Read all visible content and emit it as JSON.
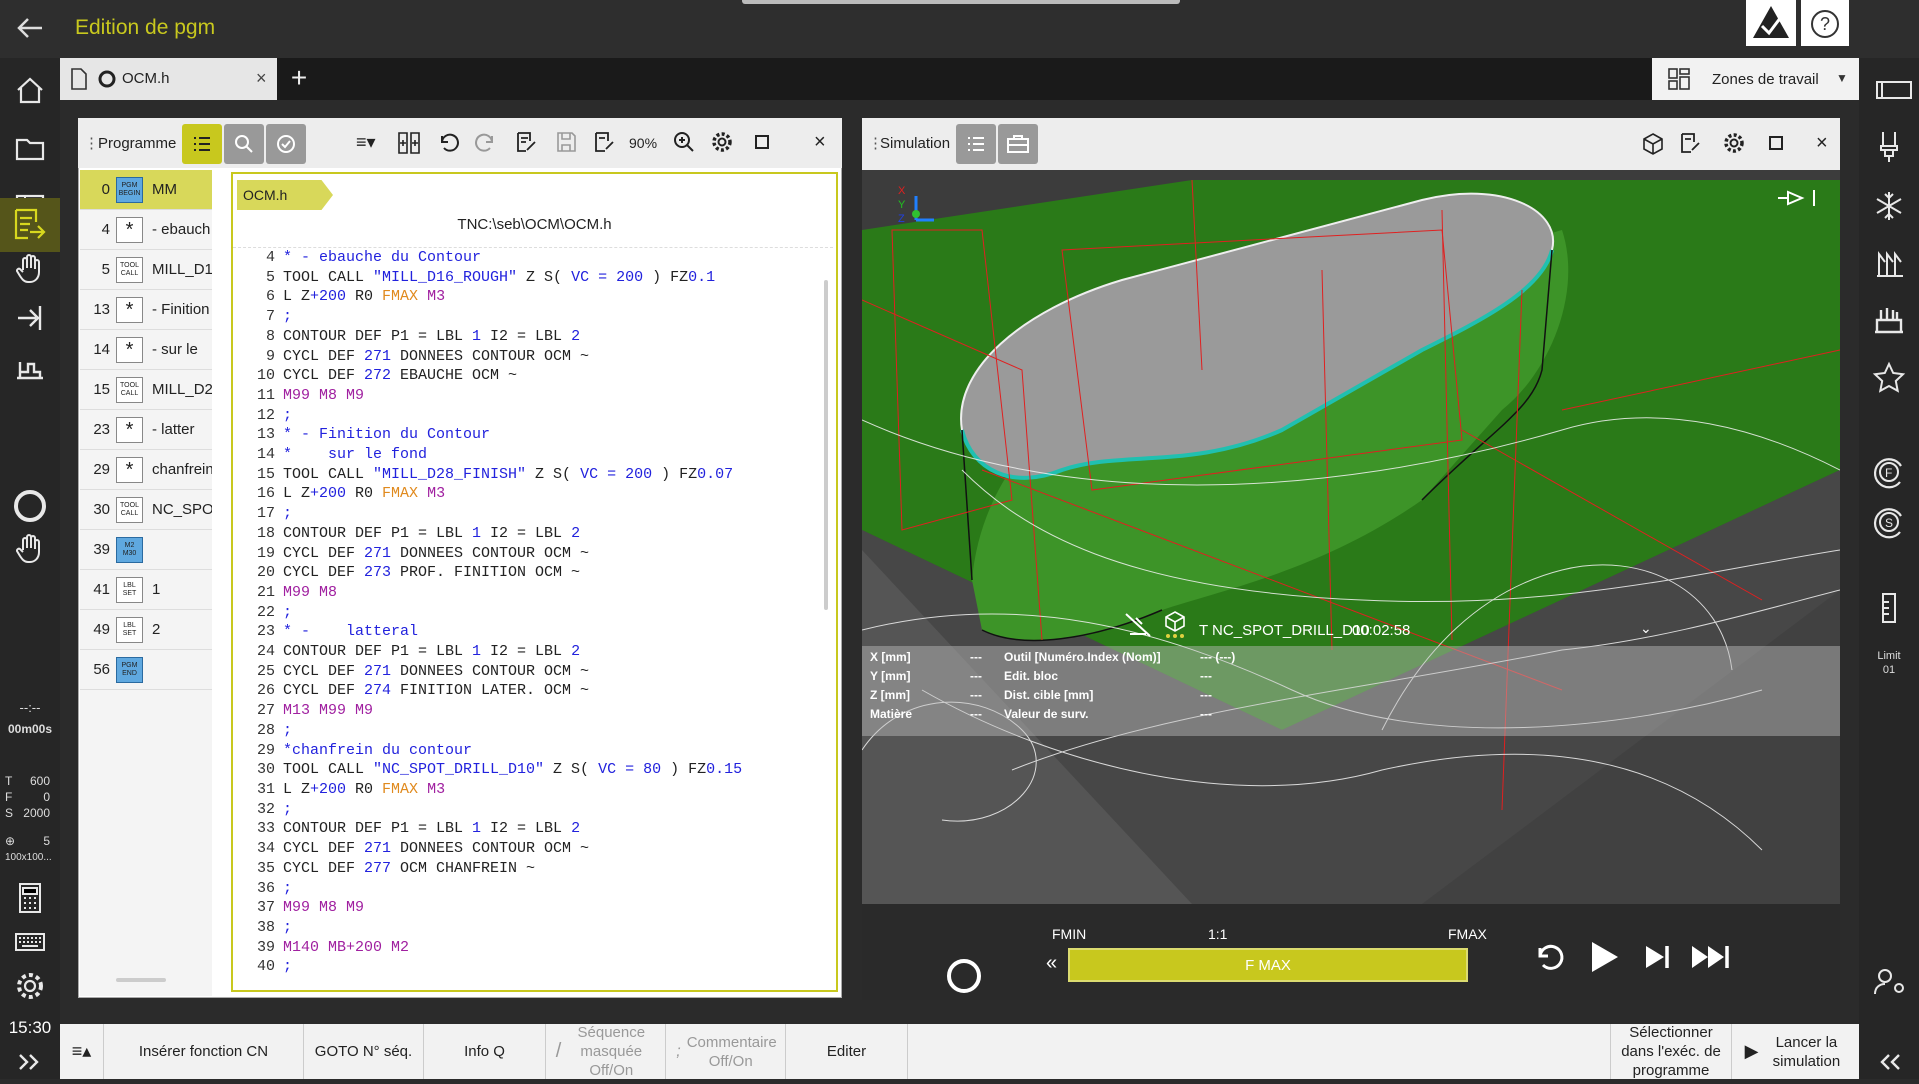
{
  "header": {
    "title": "Edition de pgm"
  },
  "tabs": [
    {
      "label": "OCM.h"
    }
  ],
  "zones": {
    "label": "Zones de travail"
  },
  "left_status": {
    "time_top": "--:--",
    "time": "00m00s",
    "T_label": "T",
    "T_value": "600",
    "F_label": "F",
    "F_value": "0",
    "S_label": "S",
    "S_value": "2000",
    "pos_value": "5",
    "pos_size": "100x100...",
    "clock": "15:30"
  },
  "program_panel": {
    "title": "Programme",
    "zoom": "90%",
    "breadcrumb": "OCM.h",
    "path": "TNC:\\seb\\OCM\\OCM.h",
    "blocks": [
      {
        "n": "0",
        "icon": "PGM BEGIN",
        "label": "MM"
      },
      {
        "n": "4",
        "icon": "*",
        "label": "- ebauch"
      },
      {
        "n": "5",
        "icon": "TOOL CALL",
        "label": "MILL_D1"
      },
      {
        "n": "13",
        "icon": "*",
        "label": "- Finition"
      },
      {
        "n": "14",
        "icon": "*",
        "label": "-    sur le"
      },
      {
        "n": "15",
        "icon": "TOOL CALL",
        "label": "MILL_D2"
      },
      {
        "n": "23",
        "icon": "*",
        "label": "-    latter"
      },
      {
        "n": "29",
        "icon": "*",
        "label": "chanfrein"
      },
      {
        "n": "30",
        "icon": "TOOL CALL",
        "label": "NC_SPO"
      },
      {
        "n": "39",
        "icon": "M2 M30",
        "label": ""
      },
      {
        "n": "41",
        "icon": "LBL SET",
        "label": "1"
      },
      {
        "n": "49",
        "icon": "LBL SET",
        "label": "2"
      },
      {
        "n": "56",
        "icon": "PGM END",
        "label": ""
      }
    ],
    "code_lines": [
      {
        "n": "4",
        "html": "<span class='bl'>* - ebauche du Contour</span>"
      },
      {
        "n": "5",
        "html": "TOOL CALL <span class='bl'>\"MILL_D16_ROUGH\"</span> Z S( <span class='bl'>VC = 200</span> ) FZ<span class='bl'>0.1</span>"
      },
      {
        "n": "6",
        "html": "L Z<span class='bl'>+200</span> R0 <span class='or'>FMAX</span> <span class='pu'>M3</span>"
      },
      {
        "n": "7",
        "html": "<span class='bl'>;</span>"
      },
      {
        "n": "8",
        "html": "CONTOUR DEF P1 = LBL <span class='bl'>1</span> I2 = LBL <span class='bl'>2</span>"
      },
      {
        "n": "9",
        "html": "CYCL DEF <span class='bl'>271</span> DONNEES CONTOUR OCM ~"
      },
      {
        "n": "10",
        "html": "CYCL DEF <span class='bl'>272</span> EBAUCHE OCM ~"
      },
      {
        "n": "11",
        "html": "<span class='pu'>M99 M8 M9</span>"
      },
      {
        "n": "12",
        "html": "<span class='bl'>;</span>"
      },
      {
        "n": "13",
        "html": "<span class='bl'>* - Finition du Contour</span>"
      },
      {
        "n": "14",
        "html": "<span class='bl'>*    sur le fond</span>"
      },
      {
        "n": "15",
        "html": "TOOL CALL <span class='bl'>\"MILL_D28_FINISH\"</span> Z S( <span class='bl'>VC = 200</span> ) FZ<span class='bl'>0.07</span>"
      },
      {
        "n": "16",
        "html": "L Z<span class='bl'>+200</span> R0 <span class='or'>FMAX</span> <span class='pu'>M3</span>"
      },
      {
        "n": "17",
        "html": "<span class='bl'>;</span>"
      },
      {
        "n": "18",
        "html": "CONTOUR DEF P1 = LBL <span class='bl'>1</span> I2 = LBL <span class='bl'>2</span>"
      },
      {
        "n": "19",
        "html": "CYCL DEF <span class='bl'>271</span> DONNEES CONTOUR OCM ~"
      },
      {
        "n": "20",
        "html": "CYCL DEF <span class='bl'>273</span> PROF. FINITION OCM ~"
      },
      {
        "n": "21",
        "html": "<span class='pu'>M99 M8</span>"
      },
      {
        "n": "22",
        "html": "<span class='bl'>;</span>"
      },
      {
        "n": "23",
        "html": "<span class='bl'>* -    latteral</span>"
      },
      {
        "n": "24",
        "html": "CONTOUR DEF P1 = LBL <span class='bl'>1</span> I2 = LBL <span class='bl'>2</span>"
      },
      {
        "n": "25",
        "html": "CYCL DEF <span class='bl'>271</span> DONNEES CONTOUR OCM ~"
      },
      {
        "n": "26",
        "html": "CYCL DEF <span class='bl'>274</span> FINITION LATER. OCM ~"
      },
      {
        "n": "27",
        "html": "<span class='pu'>M13 M99 M9</span>"
      },
      {
        "n": "28",
        "html": "<span class='bl'>;</span>"
      },
      {
        "n": "29",
        "html": "<span class='bl'>*chanfrein du contour</span>"
      },
      {
        "n": "30",
        "html": "TOOL CALL <span class='bl'>\"NC_SPOT_DRILL_D10\"</span> Z S( <span class='bl'>VC = 80</span> ) FZ<span class='bl'>0.15</span>"
      },
      {
        "n": "31",
        "html": "L Z<span class='bl'>+200</span> R0 <span class='or'>FMAX</span> <span class='pu'>M3</span>"
      },
      {
        "n": "32",
        "html": "<span class='bl'>;</span>"
      },
      {
        "n": "33",
        "html": "CONTOUR DEF P1 = LBL <span class='bl'>1</span> I2 = LBL <span class='bl'>2</span>"
      },
      {
        "n": "34",
        "html": "CYCL DEF <span class='bl'>271</span> DONNEES CONTOUR OCM ~"
      },
      {
        "n": "35",
        "html": "CYCL DEF <span class='bl'>277</span> OCM CHANFREIN ~"
      },
      {
        "n": "36",
        "html": "<span class='bl'>;</span>"
      },
      {
        "n": "37",
        "html": "<span class='pu'>M99 M8 M9</span>"
      },
      {
        "n": "38",
        "html": "<span class='bl'>;</span>"
      },
      {
        "n": "39",
        "html": "<span class='pu'>M140 MB+200 M2</span>"
      },
      {
        "n": "40",
        "html": "<span class='bl'>;</span>"
      }
    ]
  },
  "simulation_panel": {
    "title": "Simulation",
    "tool_status": "T NC_SPOT_DRILL_D10",
    "elapsed": "00:02:58",
    "info": {
      "col1": [
        "X [mm]",
        "Y [mm]",
        "Z [mm]",
        "Matière"
      ],
      "col1_vals": [
        "---",
        "---",
        "---",
        "---"
      ],
      "col2": [
        "Outil [Numéro.Index (Nom)]",
        "Edit. bloc",
        "Dist. cible [mm]",
        "Valeur de surv."
      ],
      "col2_vals": [
        "--- (---)",
        "---",
        "---",
        "---"
      ]
    },
    "fmin": "FMIN",
    "ratio": "1:1",
    "fmax": "FMAX",
    "feed_label": "F MAX",
    "feed_fraction": 1.0
  },
  "bottom_bar": {
    "insert": "Insérer fonction CN",
    "goto": "GOTO N° séq.",
    "infoq": "Info Q",
    "masked": "Séquence masquée Off/On",
    "comment": "Commentaire Off/On",
    "edit": "Editer",
    "select": "Sélectionner dans l'exéc. de programme",
    "launch": "Lancer la simulation"
  },
  "right_sidebar": {
    "limit_label": "Limit",
    "limit_value": "01"
  },
  "colors": {
    "accent": "#c8c81e",
    "active_bg": "#55551a",
    "sim_green": "#2e8a1e"
  }
}
